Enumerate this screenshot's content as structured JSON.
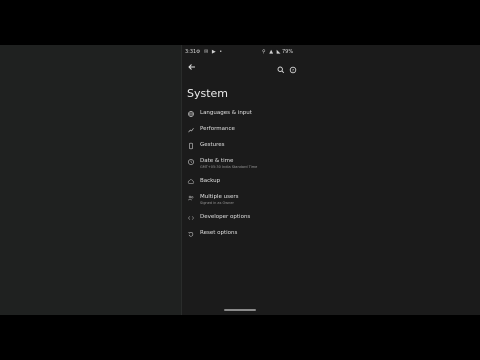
{
  "status_bar": {
    "time": "3:31",
    "left_icons": "⚙ ✉ ▶ •",
    "right_icons": "⚲ ▲ ◣",
    "battery": "79%"
  },
  "toolbar": {
    "back_icon": "arrow-back-icon",
    "search_icon": "search-icon",
    "help_icon": "help-icon"
  },
  "page": {
    "title": "System"
  },
  "settings": [
    {
      "label": "Languages & input",
      "subtitle": "",
      "icon": "globe-icon"
    },
    {
      "label": "Performance",
      "subtitle": "",
      "icon": "performance-icon"
    },
    {
      "label": "Gestures",
      "subtitle": "",
      "icon": "phone-icon"
    },
    {
      "label": "Date & time",
      "subtitle": "GMT+05:30 India Standard Time",
      "icon": "clock-icon"
    },
    {
      "label": "Backup",
      "subtitle": "",
      "icon": "backup-icon"
    },
    {
      "label": "Multiple users",
      "subtitle": "Signed in as Owner",
      "icon": "users-icon"
    },
    {
      "label": "Developer options",
      "subtitle": "",
      "icon": "code-icon"
    },
    {
      "label": "Reset options",
      "subtitle": "",
      "icon": "reset-icon"
    }
  ],
  "colors": {
    "background": "#1b1b1b",
    "left_pane": "#1f2120",
    "text_primary": "#e4e4e4",
    "text_secondary": "#9a9a9a"
  }
}
